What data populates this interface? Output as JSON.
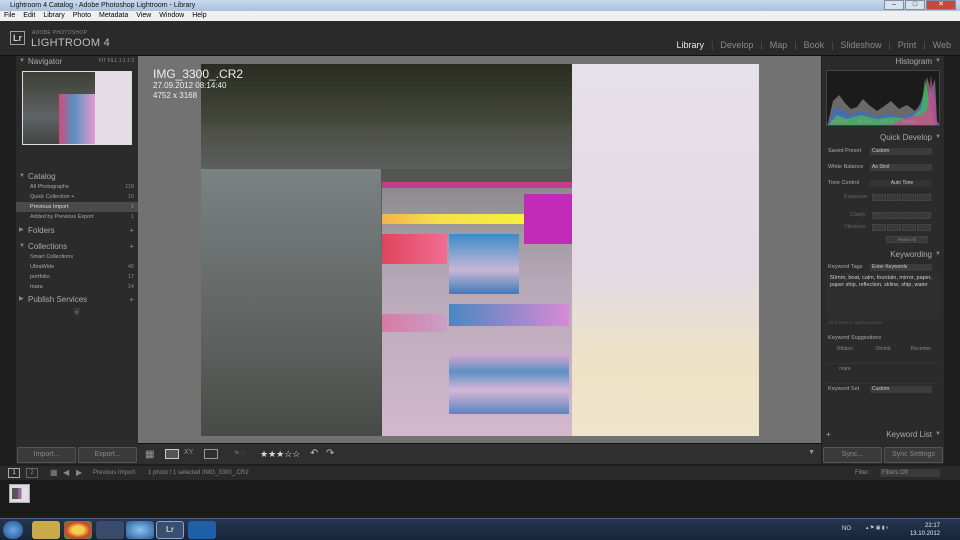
{
  "window": {
    "title": "Lightroom 4 Catalog - Adobe Photoshop Lightroom - Library"
  },
  "menu": [
    "File",
    "Edit",
    "Library",
    "Photo",
    "Metadata",
    "View",
    "Window",
    "Help"
  ],
  "brand": {
    "badge": "Lr",
    "small": "ADOBE PHOTOSHOP",
    "big": "LIGHTROOM 4"
  },
  "modules": [
    "Library",
    "Develop",
    "Map",
    "Book",
    "Slideshow",
    "Print",
    "Web"
  ],
  "left": {
    "navigator": {
      "title": "Navigator",
      "zoom": [
        "FIT",
        "FILL",
        "1:1",
        "1:3"
      ]
    },
    "catalog": {
      "title": "Catalog",
      "items": [
        {
          "label": "All Photographs",
          "count": "118"
        },
        {
          "label": "Quick Collection +",
          "count": "10"
        },
        {
          "label": "Previous Import",
          "count": "1"
        },
        {
          "label": "Added by Previous Export",
          "count": "1"
        }
      ]
    },
    "folders": {
      "title": "Folders"
    },
    "collections": {
      "title": "Collections",
      "items": [
        {
          "label": "Smart Collections",
          "count": ""
        },
        {
          "label": "UltraWide",
          "count": "49"
        },
        {
          "label": "portfolio",
          "count": "17"
        },
        {
          "label": "mara",
          "count": "14"
        }
      ]
    },
    "publish": {
      "title": "Publish Services"
    },
    "import_label": "Import...",
    "export_label": "Export..."
  },
  "photo": {
    "filename": "IMG_3300_.CR2",
    "datetime": "27.09.2012 08:14:40",
    "dimensions": "4752 x 3168"
  },
  "right": {
    "histogram": {
      "title": "Histogram",
      "info": [
        "ISO 100",
        "50 mm",
        "f / 1.8",
        "1/1250"
      ]
    },
    "quick_develop": {
      "title": "Quick Develop",
      "saved_preset_label": "Saved Preset",
      "saved_preset_value": "Custom",
      "white_balance_label": "White Balance",
      "white_balance_value": "As Shot",
      "tone_control_label": "Tone Control",
      "auto_tone_label": "Auto Tone",
      "exposure_label": "Exposure",
      "clarity_label": "Clarity",
      "vibrance_label": "Vibrance",
      "reset_label": "Reset All"
    },
    "keywording": {
      "title": "Keywording",
      "tags_label": "Keyword Tags",
      "tags_mode": "Enter Keywords",
      "keywords": "50mm, boat, calm, fountain, mirror, paper, paper ship, reflection, skline, ship, water",
      "hint": "Click here to add keywords",
      "suggestions_label": "Keyword Suggestions",
      "suggestions": [
        "Ribbon",
        "Orchid",
        "Recenter",
        "mara",
        "",
        ""
      ],
      "set_label": "Keyword Set",
      "set_value": "Custom"
    },
    "keyword_list_title": "Keyword List",
    "sync_label": "Sync...",
    "sync_settings_label": "Sync Settings"
  },
  "filmbar": {
    "pages": [
      "1",
      "2"
    ],
    "source": "Previous Import",
    "info": "1 photo / 1 selected /IMG_3300_.CR2",
    "filter_label": "Filter :",
    "filter_value": "Filters Off"
  },
  "taskbar": {
    "lang": "NO",
    "time": "22:17",
    "date": "13.10.2012"
  },
  "colors": {
    "accent": "#e8e8e8",
    "panel": "#2b2b2b",
    "canvas": "#727272"
  }
}
